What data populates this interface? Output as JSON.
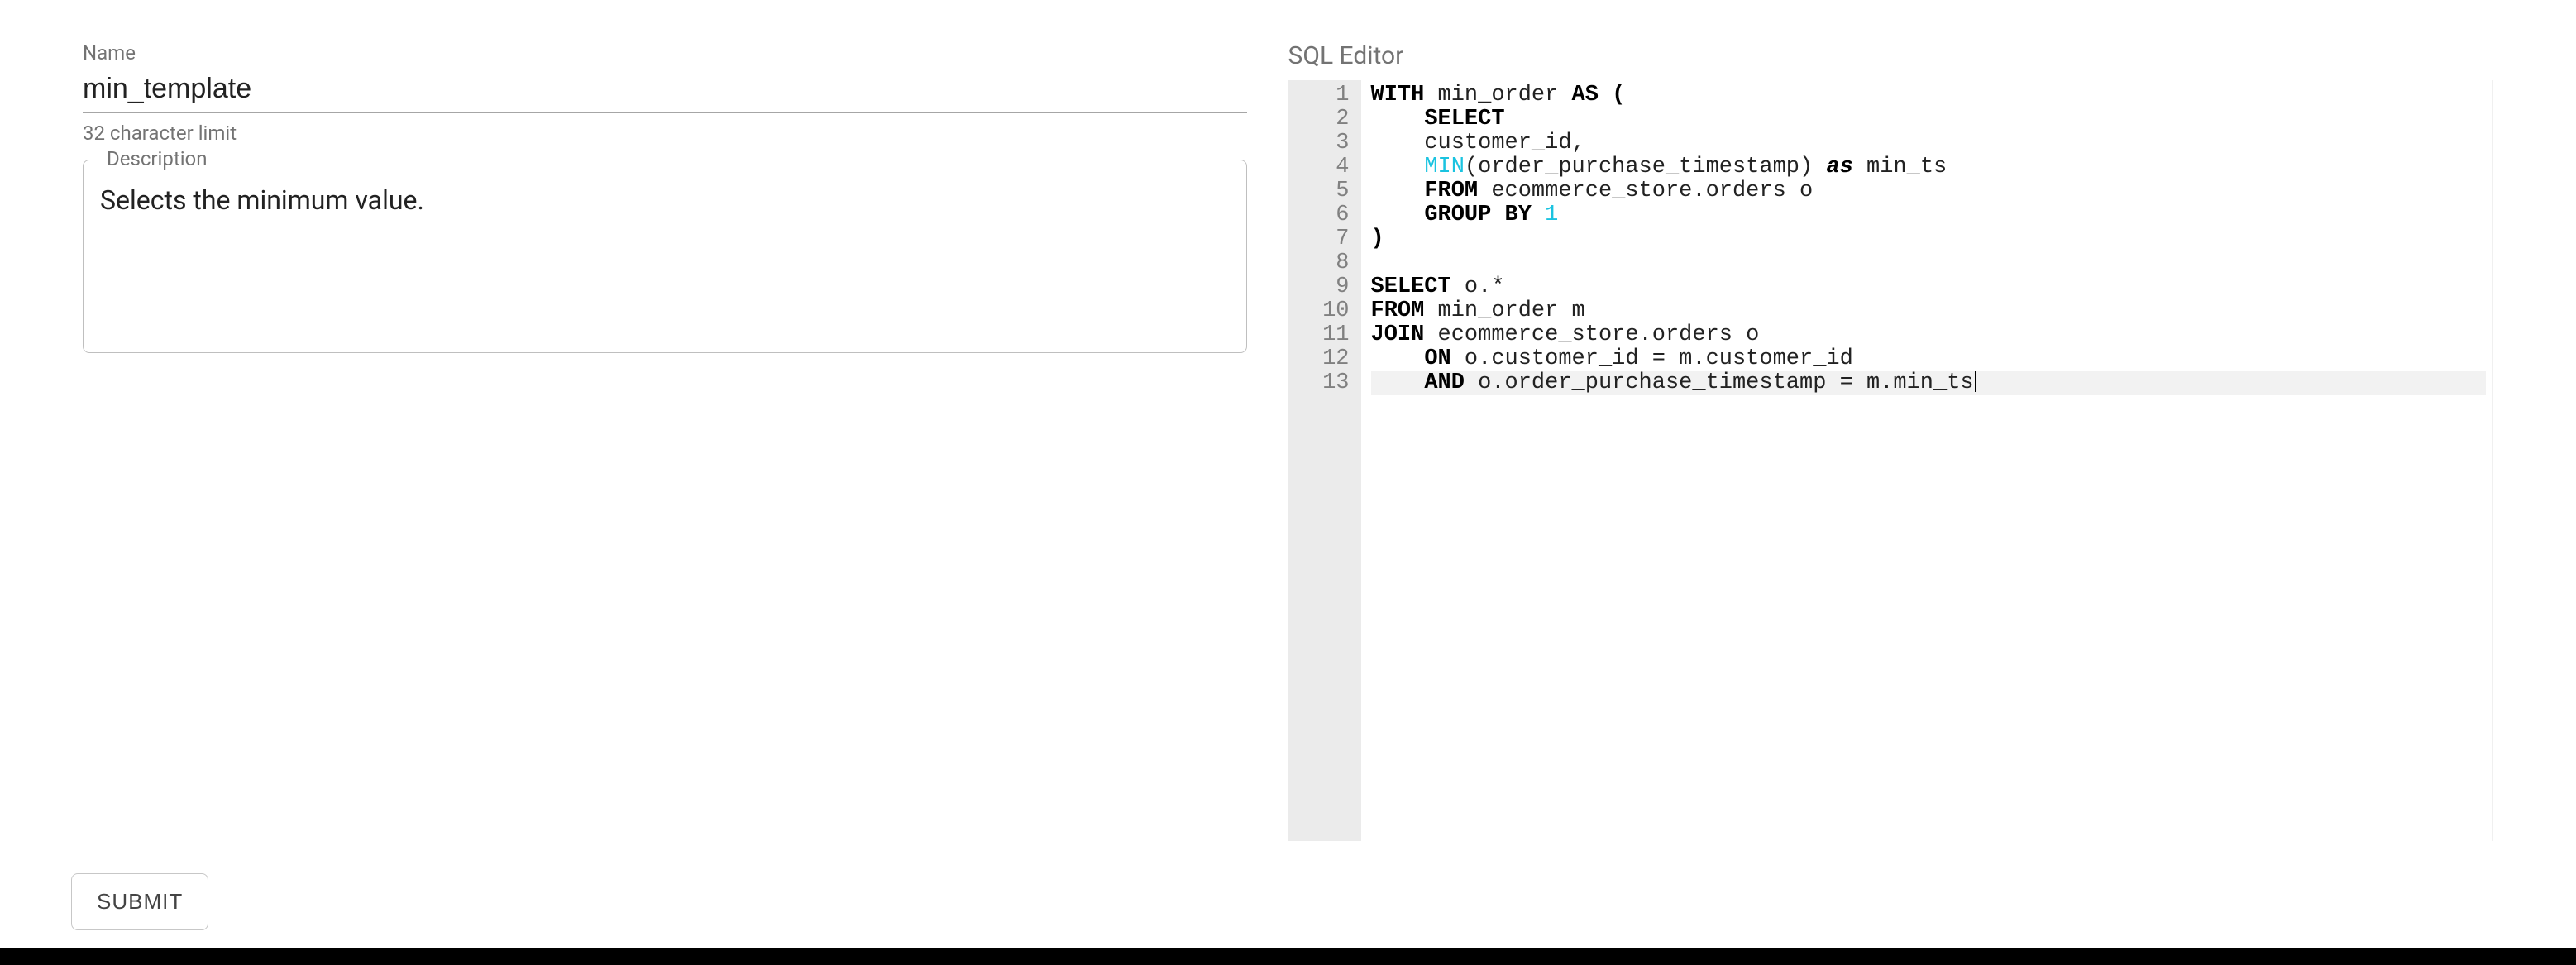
{
  "form": {
    "name_label": "Name",
    "name_value": "min_template",
    "name_helper": "32 character limit",
    "description_label": "Description",
    "description_value": "Selects the minimum value.",
    "submit_label": "SUBMIT"
  },
  "editor": {
    "title": "SQL Editor",
    "active_line": 13,
    "lines": [
      {
        "num": 1,
        "tokens": [
          {
            "t": "kw",
            "v": "WITH"
          },
          {
            "t": "",
            "v": " min_order "
          },
          {
            "t": "kw",
            "v": "AS"
          },
          {
            "t": "",
            "v": " "
          },
          {
            "t": "kw",
            "v": "("
          }
        ]
      },
      {
        "num": 2,
        "indent": 4,
        "tokens": [
          {
            "t": "kw",
            "v": "SELECT"
          }
        ]
      },
      {
        "num": 3,
        "indent": 4,
        "tokens": [
          {
            "t": "",
            "v": "customer_id,"
          }
        ]
      },
      {
        "num": 4,
        "indent": 4,
        "tokens": [
          {
            "t": "fn",
            "v": "MIN"
          },
          {
            "t": "",
            "v": "(order_purchase_timestamp) "
          },
          {
            "t": "as",
            "v": "as"
          },
          {
            "t": "",
            "v": " min_ts"
          }
        ]
      },
      {
        "num": 5,
        "indent": 4,
        "tokens": [
          {
            "t": "kw",
            "v": "FROM"
          },
          {
            "t": "",
            "v": " ecommerce_store.orders o"
          }
        ]
      },
      {
        "num": 6,
        "indent": 4,
        "tokens": [
          {
            "t": "kw",
            "v": "GROUP BY"
          },
          {
            "t": "",
            "v": " "
          },
          {
            "t": "num",
            "v": "1"
          }
        ]
      },
      {
        "num": 7,
        "tokens": [
          {
            "t": "kw",
            "v": ")"
          }
        ]
      },
      {
        "num": 8,
        "tokens": []
      },
      {
        "num": 9,
        "tokens": [
          {
            "t": "kw",
            "v": "SELECT"
          },
          {
            "t": "",
            "v": " o.*"
          }
        ]
      },
      {
        "num": 10,
        "tokens": [
          {
            "t": "kw",
            "v": "FROM"
          },
          {
            "t": "",
            "v": " min_order m"
          }
        ]
      },
      {
        "num": 11,
        "tokens": [
          {
            "t": "kw",
            "v": "JOIN"
          },
          {
            "t": "",
            "v": " ecommerce_store.orders o"
          }
        ]
      },
      {
        "num": 12,
        "indent": 4,
        "tokens": [
          {
            "t": "kw",
            "v": "ON"
          },
          {
            "t": "",
            "v": " o.customer_id = m.customer_id"
          }
        ]
      },
      {
        "num": 13,
        "indent": 4,
        "tokens": [
          {
            "t": "kw",
            "v": "AND"
          },
          {
            "t": "",
            "v": " o.order_purchase_timestamp = m.min_ts"
          }
        ]
      }
    ]
  }
}
